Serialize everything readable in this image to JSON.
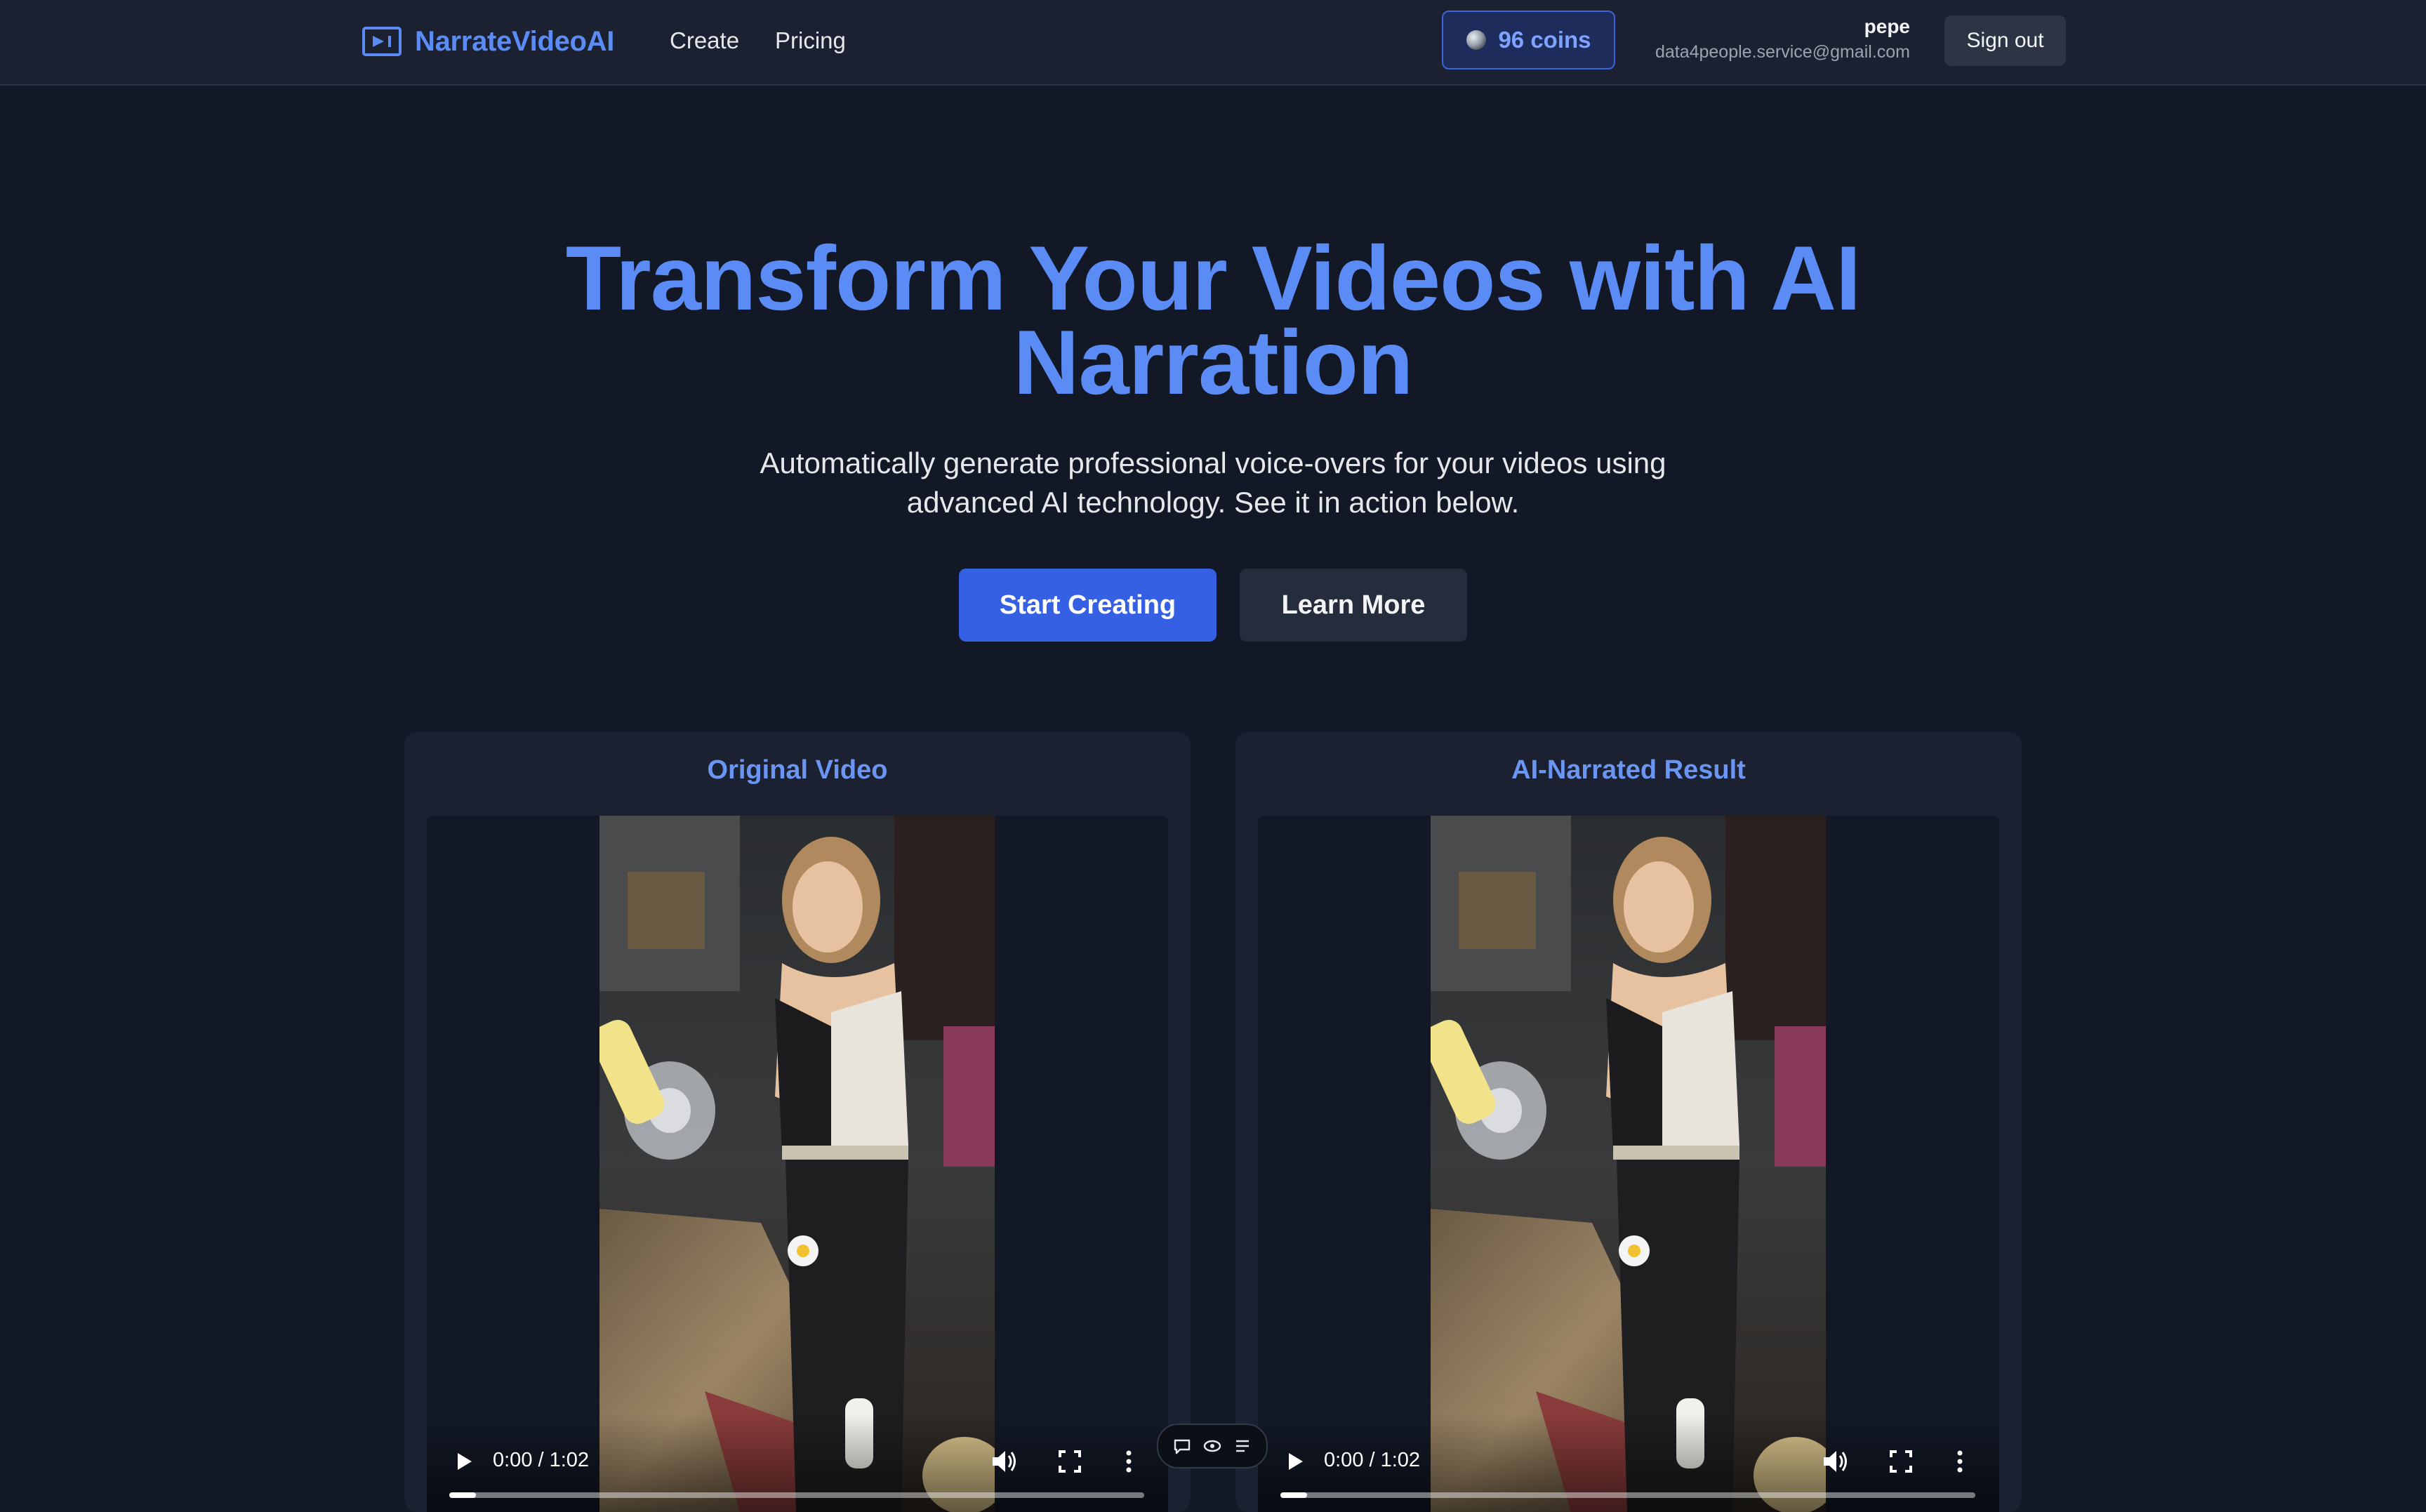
{
  "header": {
    "logo_text": "NarrateVideoAI",
    "logo_icon": "video-play-icon",
    "nav": [
      {
        "label": "Create"
      },
      {
        "label": "Pricing"
      }
    ],
    "coins_label": "96 coins",
    "coin_icon": "coin-icon",
    "user": {
      "name": "pepe",
      "email": "data4people.service@gmail.com"
    },
    "signout_label": "Sign out"
  },
  "hero": {
    "title_line1": "Transform Your Videos with AI",
    "title_line2": "Narration",
    "subtitle_line1": "Automatically generate professional voice-overs for your videos using",
    "subtitle_line2": "advanced AI technology. See it in action below.",
    "primary_button": "Start Creating",
    "secondary_button": "Learn More"
  },
  "videos": [
    {
      "title": "Original Video",
      "time": "0:00 / 1:02",
      "progress": 0.0
    },
    {
      "title": "AI-Narrated Result",
      "time": "0:00 / 1:02",
      "progress": 0.0
    }
  ],
  "mini_toolbar": {
    "icons": [
      "comment-icon",
      "eye-icon",
      "list-icon"
    ]
  },
  "colors": {
    "page_bg": "#121826",
    "header_bg": "#1b2130",
    "accent": "#5b8cf5",
    "primary_button": "#3560e3",
    "card_bg": "#1b2130"
  }
}
